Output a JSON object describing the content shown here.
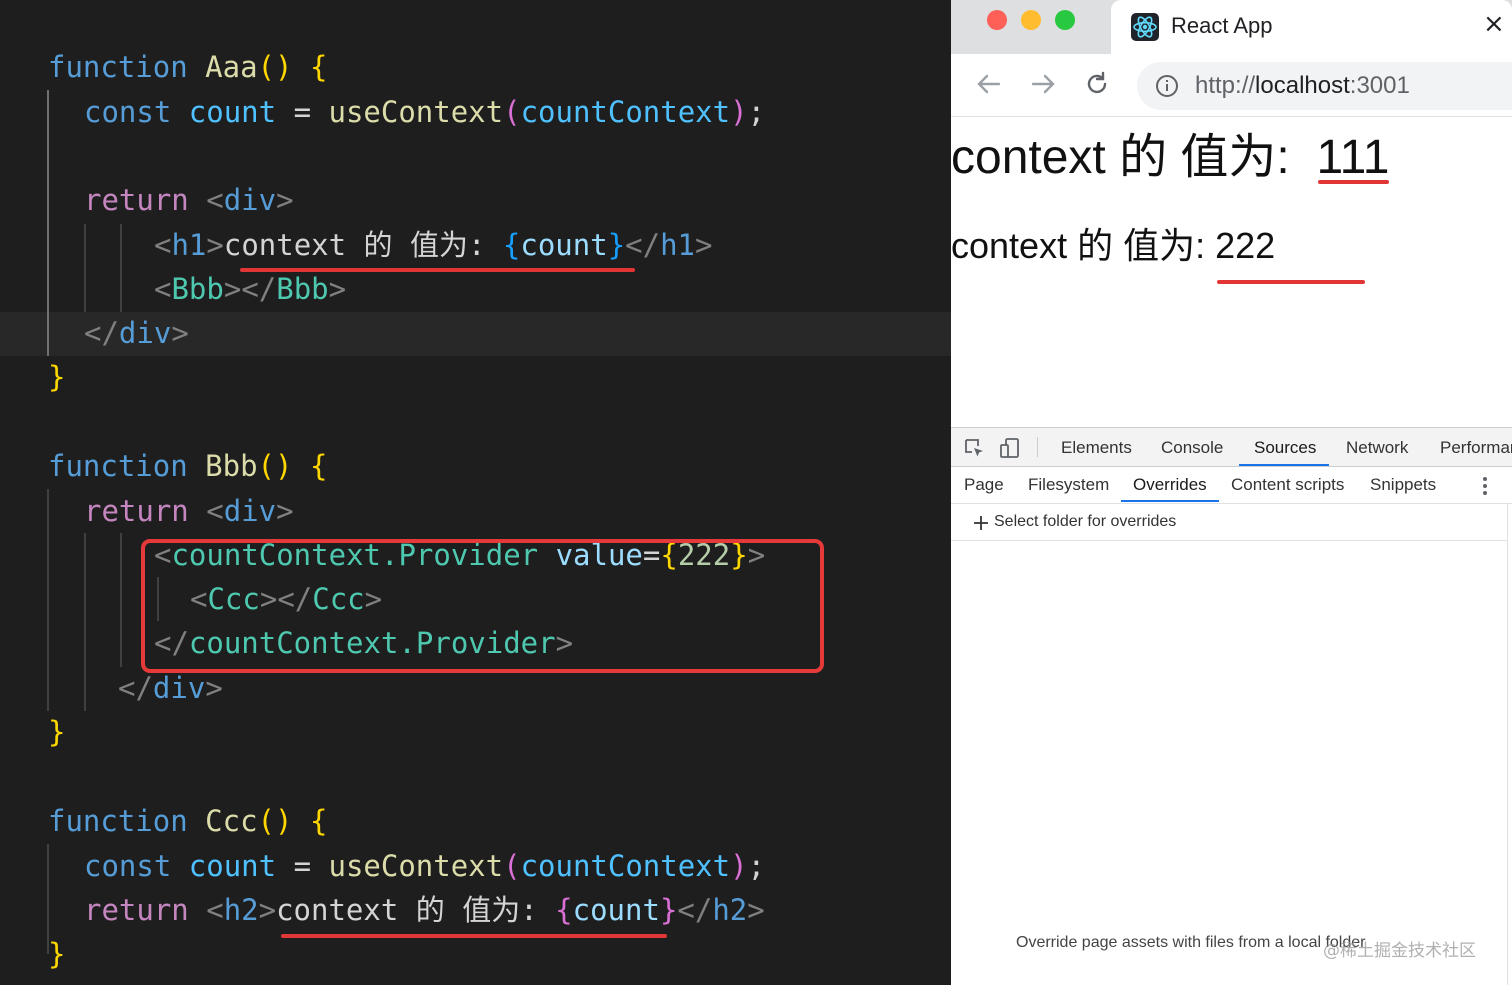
{
  "editor": {
    "aaa": {
      "kw": "function",
      "name": "Aaa",
      "parens": "()",
      "brace_open": "{",
      "const_kw": "const",
      "var": "count",
      "eq": "=",
      "hook": "useContext",
      "lp": "(",
      "arg": "countContext",
      "rp": ")",
      "semi": ";",
      "return_kw": "return",
      "lt": "<",
      "div": "div",
      "gt": ">",
      "h1": "h1",
      "h1_text": "context 的 值为: ",
      "jsx_open": "{",
      "jsx_var": "count",
      "jsx_close": "}",
      "close_lt": "</",
      "bbb_tag": "Bbb",
      "brace_close": "}"
    },
    "bbb": {
      "kw": "function",
      "name": "Bbb",
      "parens": "()",
      "brace_open": "{",
      "return_kw": "return",
      "div": "div",
      "provider": "countContext.Provider",
      "attr": "value",
      "eq": "=",
      "val_open": "{",
      "val": "222",
      "val_close": "}",
      "ccc_tag": "Ccc",
      "brace_close": "}"
    },
    "ccc": {
      "kw": "function",
      "name": "Ccc",
      "parens": "()",
      "brace_open": "{",
      "const_kw": "const",
      "var": "count",
      "eq": "=",
      "hook": "useContext",
      "arg": "countContext",
      "return_kw": "return",
      "h2": "h2",
      "h2_text": "context 的 值为: ",
      "jsx_var": "count",
      "brace_close": "}"
    }
  },
  "browser": {
    "tab_title": "React App",
    "tab_close": "×",
    "url_scheme": "http://",
    "url_host": "localhost",
    "url_port": ":3001",
    "page": {
      "h1_label": "context 的 值为:",
      "h1_value": "111",
      "h2_label": "context 的 值为:",
      "h2_value": "222"
    },
    "devtools": {
      "tabs": [
        "Elements",
        "Console",
        "Sources",
        "Network",
        "Performar"
      ],
      "active_tab": "Sources",
      "subtabs": [
        "Page",
        "Filesystem",
        "Overrides",
        "Content scripts",
        "Snippets"
      ],
      "active_subtab": "Overrides",
      "more_icon": "more-vert-icon",
      "select_folder": "Select folder for overrides",
      "override_message": "Override page assets with files from a local folder"
    }
  },
  "watermark": "@稀土掘金技术社区",
  "colors": {
    "accent": "#1a73e8",
    "underline_red": "#e23535",
    "traffic_close": "#fe5f57",
    "traffic_min": "#febc2e",
    "traffic_max": "#28c840"
  }
}
